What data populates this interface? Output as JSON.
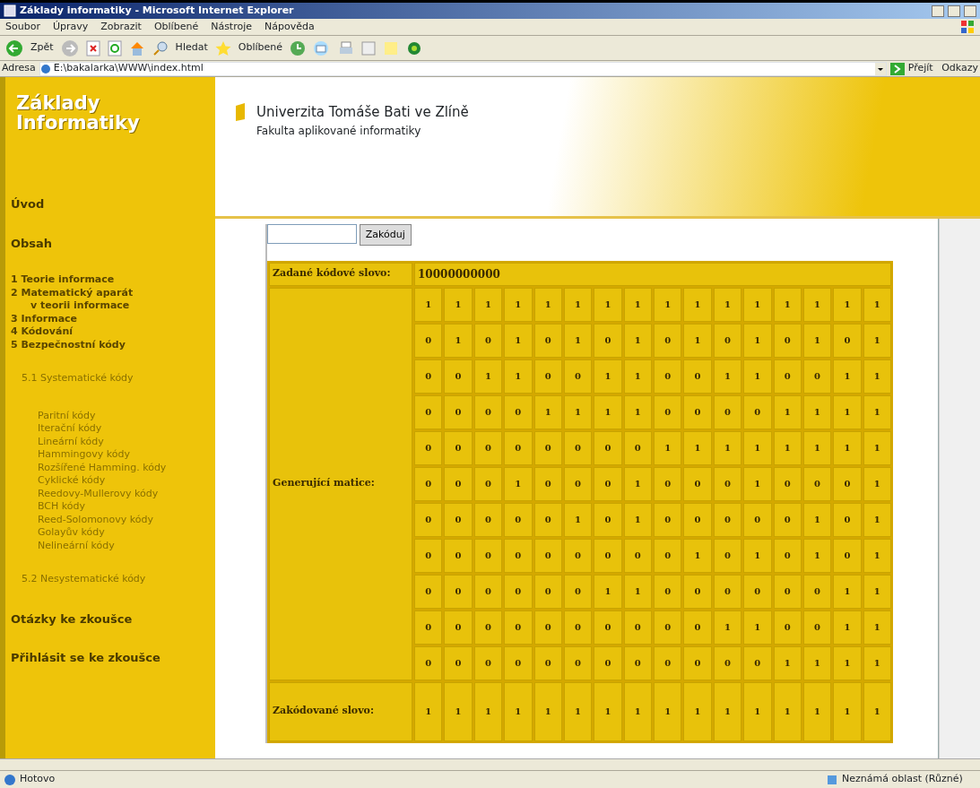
{
  "window": {
    "title": "Základy informatiky - Microsoft Internet Explorer"
  },
  "menu": [
    "Soubor",
    "Úpravy",
    "Zobrazit",
    "Oblíbené",
    "Nástroje",
    "Nápověda"
  ],
  "toolbar": {
    "back": "Zpět",
    "search": "Hledat",
    "favorites": "Oblíbené"
  },
  "address": {
    "label": "Adresa",
    "value": "E:\\bakalarka\\WWW\\index.html",
    "go": "Přejít",
    "links": "Odkazy"
  },
  "sidebar": {
    "logo": [
      "Základy",
      "Informatiky"
    ],
    "items": [
      {
        "label": "Úvod",
        "kind": "main"
      },
      {
        "label": "Obsah",
        "kind": "main"
      },
      {
        "label": "1 Teorie informace",
        "kind": "chapter"
      },
      {
        "label": "2 Matematický aparát",
        "kind": "chapter"
      },
      {
        "label": "v teorii informace",
        "kind": "chapter-cont"
      },
      {
        "label": "3 Informace",
        "kind": "chapter"
      },
      {
        "label": "4 Kódování",
        "kind": "chapter"
      },
      {
        "label": "5 Bezpečnostní kódy",
        "kind": "chapter"
      },
      {
        "label": "5.1 Systematické kódy",
        "kind": "section"
      },
      {
        "label": "Paritní kódy",
        "kind": "sub"
      },
      {
        "label": "Iterační kódy",
        "kind": "sub"
      },
      {
        "label": "Lineární kódy",
        "kind": "sub"
      },
      {
        "label": "Hammingovy kódy",
        "kind": "sub"
      },
      {
        "label": "Rozšířené Hamming. kódy",
        "kind": "sub"
      },
      {
        "label": "Cyklické kódy",
        "kind": "sub"
      },
      {
        "label": "Reedovy-Mullerovy kódy",
        "kind": "sub"
      },
      {
        "label": "BCH kódy",
        "kind": "sub"
      },
      {
        "label": "Reed-Solomonovy kódy",
        "kind": "sub"
      },
      {
        "label": "Golayův kódy",
        "kind": "sub"
      },
      {
        "label": "Nelineární kódy",
        "kind": "sub"
      },
      {
        "label": "5.2 Nesystematické kódy",
        "kind": "section"
      },
      {
        "label": "Otázky ke zkoušce",
        "kind": "main"
      },
      {
        "label": "Přihlásit se ke zkoušce",
        "kind": "main-cut"
      }
    ]
  },
  "header": {
    "university": "Univerzita Tomáše Bati ve Zlíně",
    "faculty": "Fakulta aplikované informatiky"
  },
  "form": {
    "button": "Zakóduj"
  },
  "result": {
    "input_label": "Zadané kódové slovo:",
    "input_value": "10000000000",
    "matrix_label": "Generující matice:",
    "matrix": [
      [
        "1",
        "1",
        "1",
        "1",
        "1",
        "1",
        "1",
        "1",
        "1",
        "1",
        "1",
        "1",
        "1",
        "1",
        "1",
        "1"
      ],
      [
        "0",
        "1",
        "0",
        "1",
        "0",
        "1",
        "0",
        "1",
        "0",
        "1",
        "0",
        "1",
        "0",
        "1",
        "0",
        "1"
      ],
      [
        "0",
        "0",
        "1",
        "1",
        "0",
        "0",
        "1",
        "1",
        "0",
        "0",
        "1",
        "1",
        "0",
        "0",
        "1",
        "1"
      ],
      [
        "0",
        "0",
        "0",
        "0",
        "1",
        "1",
        "1",
        "1",
        "0",
        "0",
        "0",
        "0",
        "1",
        "1",
        "1",
        "1"
      ],
      [
        "0",
        "0",
        "0",
        "0",
        "0",
        "0",
        "0",
        "0",
        "1",
        "1",
        "1",
        "1",
        "1",
        "1",
        "1",
        "1"
      ],
      [
        "0",
        "0",
        "0",
        "1",
        "0",
        "0",
        "0",
        "1",
        "0",
        "0",
        "0",
        "1",
        "0",
        "0",
        "0",
        "1"
      ],
      [
        "0",
        "0",
        "0",
        "0",
        "0",
        "1",
        "0",
        "1",
        "0",
        "0",
        "0",
        "0",
        "0",
        "1",
        "0",
        "1"
      ],
      [
        "0",
        "0",
        "0",
        "0",
        "0",
        "0",
        "0",
        "0",
        "0",
        "1",
        "0",
        "1",
        "0",
        "1",
        "0",
        "1"
      ],
      [
        "0",
        "0",
        "0",
        "0",
        "0",
        "0",
        "1",
        "1",
        "0",
        "0",
        "0",
        "0",
        "0",
        "0",
        "1",
        "1"
      ],
      [
        "0",
        "0",
        "0",
        "0",
        "0",
        "0",
        "0",
        "0",
        "0",
        "0",
        "1",
        "1",
        "0",
        "0",
        "1",
        "1"
      ],
      [
        "0",
        "0",
        "0",
        "0",
        "0",
        "0",
        "0",
        "0",
        "0",
        "0",
        "0",
        "0",
        "1",
        "1",
        "1",
        "1"
      ]
    ],
    "encoded_label": "Zakódované slovo:",
    "encoded": [
      "1",
      "1",
      "1",
      "1",
      "1",
      "1",
      "1",
      "1",
      "1",
      "1",
      "1",
      "1",
      "1",
      "1",
      "1",
      "1"
    ]
  },
  "status_bar": {
    "text": "Hotovo",
    "zone": "Neznámá oblast (Různé)"
  }
}
